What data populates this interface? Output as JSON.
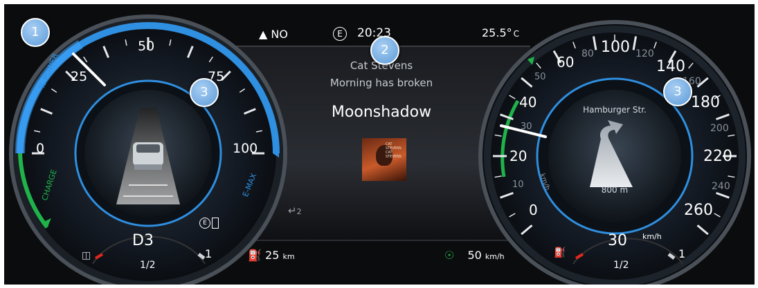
{
  "status_bar": {
    "heading": "NO",
    "time": "20:23",
    "temperature_value": "25.5°",
    "temperature_unit": "C",
    "eco_symbol": "E"
  },
  "media": {
    "artist": "Cat Stevens",
    "album": "Morning has broken",
    "track": "Moonshadow",
    "album_art_text_1": "CAT STEVENS",
    "album_art_text_2": "CAT STEVENS"
  },
  "left_gauge": {
    "labels": [
      "0",
      "25",
      "50",
      "75",
      "100"
    ],
    "power_label": "% POWER",
    "charge_label": "CHARGE",
    "emax_label": "E-MAX",
    "gear": "D3",
    "charge_gauge_ticks": [
      "1/2",
      "1"
    ],
    "eco_symbol": "E",
    "power_level_percent": 30
  },
  "right_gauge": {
    "outer_labels": [
      "80",
      "100",
      "120",
      "140",
      "160",
      "180",
      "200",
      "220",
      "240",
      "260"
    ],
    "inner_labels": [
      "0",
      "10",
      "20",
      "30",
      "40",
      "50",
      "60"
    ],
    "speed_unit_kmh": "km/h",
    "speed_unit_mph": "km/h",
    "navigation_street": "Hamburger Str.",
    "navigation_distance": "800 m",
    "speed_value": "30",
    "speed_unit": "km/h",
    "fuel_gauge_ticks": [
      "1/2",
      "1"
    ]
  },
  "bottom_bar": {
    "range_value": "25",
    "range_unit": "km",
    "acc_speed_value": "50",
    "acc_speed_unit": "km/h",
    "cruise_indicator": "2"
  },
  "callouts": [
    "1",
    "2",
    "3",
    "3"
  ],
  "colors": {
    "accent_blue": "#2f8fe0",
    "charge_green": "#1fb34a",
    "needle": "#ffffff",
    "warning_red": "#e0281e"
  }
}
